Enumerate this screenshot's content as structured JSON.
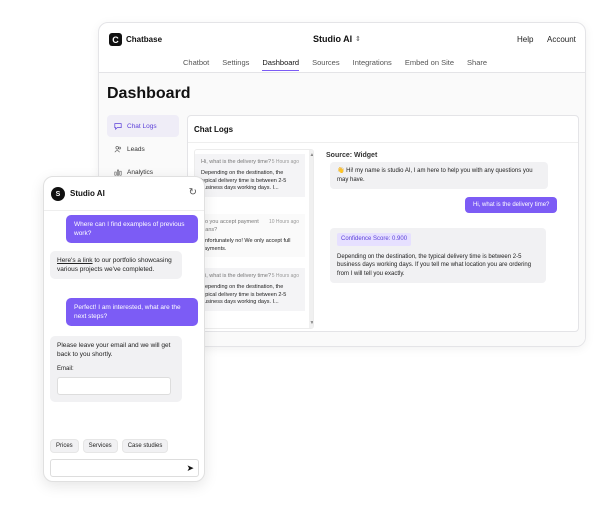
{
  "app": {
    "logo_letter": "C",
    "brand": "Chatbase",
    "project": "Studio AI",
    "project_chevron": "⇕",
    "help": "Help",
    "account": "Account",
    "accent_color": "#7c5cf5"
  },
  "nav": {
    "tabs": [
      "Chatbot",
      "Settings",
      "Dashboard",
      "Sources",
      "Integrations",
      "Embed on Site",
      "Share"
    ],
    "active": "Dashboard"
  },
  "dashboard": {
    "title": "Dashboard",
    "sidebar": [
      {
        "label": "Chat Logs",
        "icon": "chat-icon",
        "active": true
      },
      {
        "label": "Leads",
        "icon": "users-icon",
        "active": false
      },
      {
        "label": "Analytics",
        "icon": "bar-chart-icon",
        "active": false
      }
    ],
    "logs_title": "Chat Logs",
    "conversations": [
      {
        "question": "Hi, what is the delivery time?",
        "time": "5 Hours ago",
        "answer": "Depending on the destination, the typical delivery time is between 2-5 business days working days. I..."
      },
      {
        "question": "Do you accept payment plans?",
        "time": "10 Hours ago",
        "answer": "Unfortunately no! We only accept full payments."
      },
      {
        "question": "Hi, what is the delivery time?",
        "time": "5 Hours ago",
        "answer": "Depending on the destination, the typical delivery time is between 2-5 business days working days. I..."
      }
    ],
    "source": "Source: Widget",
    "messages": {
      "greeting": "👋 Hi! my name is studio AI, I am here to help you with any questions you may have.",
      "user_question": "Hi, what is the delivery time?",
      "confidence": "Confidence Score: 0.900",
      "answer": "Depending on the destination, the typical delivery time is between 2-5 business days working days. If you tell me what location you are ordering from I will tell you exactly."
    }
  },
  "widget": {
    "avatar_letter": "S",
    "name": "Studio AI",
    "user_msg_1": "Where can I find examples of previous work?",
    "bot_msg_1_link": "Here's a link",
    "bot_msg_1_rest": " to our portfolio showcasing various projects we've completed.",
    "user_msg_2": "Perfect! I am interested, what are the next steps?",
    "bot_msg_2": "Please leave your email and we will get back to you shortly.",
    "email_label": "Email:",
    "chips": [
      "Prices",
      "Services",
      "Case studies"
    ]
  }
}
